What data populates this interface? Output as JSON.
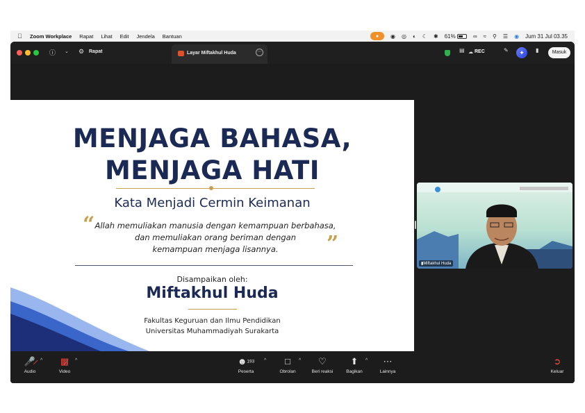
{
  "menubar": {
    "app": "Zoom Workplace",
    "items": [
      "Rapat",
      "Lihat",
      "Edit",
      "Jendela",
      "Bantuan"
    ],
    "battery_percent": "61%",
    "battery_level": 0.61,
    "datetime": "Jum 31 Jul  03.35"
  },
  "titlebar": {
    "meeting_label": "Rapat",
    "tab_label": "Layar Miftakhul Huda",
    "rec_label": "REC",
    "signin_label": "Masuk"
  },
  "slide": {
    "title_line1": "MENJAGA BAHASA,",
    "title_line2": "MENJAGA HATI",
    "subtitle": "Kata Menjadi Cermin Keimanan",
    "quote_lines": [
      "Allah memuliakan manusia dengan kemampuan berbahasa,",
      "dan memuliakan orang beriman dengan",
      "kemampuan menjaga lisannya."
    ],
    "presented_by": "Disampaikan oleh:",
    "speaker": "Miftakhul Huda",
    "affiliation_line1": "Fakultas Keguruan dan Ilmu Pendidikan",
    "affiliation_line2": "Universitas Muhammadiyah Surakarta"
  },
  "video": {
    "participant_name": "Miftakhul Huda"
  },
  "controls": {
    "audio": "Audio",
    "video": "Video",
    "participants": "Peserta",
    "participant_count": "193",
    "chat": "Obrolan",
    "reactions": "Beri reaksi",
    "share": "Bagikan",
    "more": "Lainnya",
    "leave": "Keluar"
  },
  "colors": {
    "slide_navy": "#1b2a55",
    "slide_gold": "#c6a04e",
    "window_bg": "#1c1c1c",
    "mic_active": "#f0902a",
    "leave_red": "#e0433b"
  },
  "icons": [
    "apple-icon",
    "mic-indicator-icon",
    "bluetooth-icon",
    "wifi-icon",
    "search-icon",
    "control-center-icon",
    "siri-icon",
    "info-icon",
    "chevron-down-icon",
    "meeting-icon",
    "more-icon",
    "shield-icon",
    "notes-icon",
    "cloud-icon",
    "edit-icon",
    "ai-companion-icon",
    "apps-icon",
    "mic-muted-icon",
    "video-off-icon",
    "participants-icon",
    "chat-icon",
    "heart-icon",
    "share-icon",
    "more-icon",
    "leave-icon"
  ]
}
